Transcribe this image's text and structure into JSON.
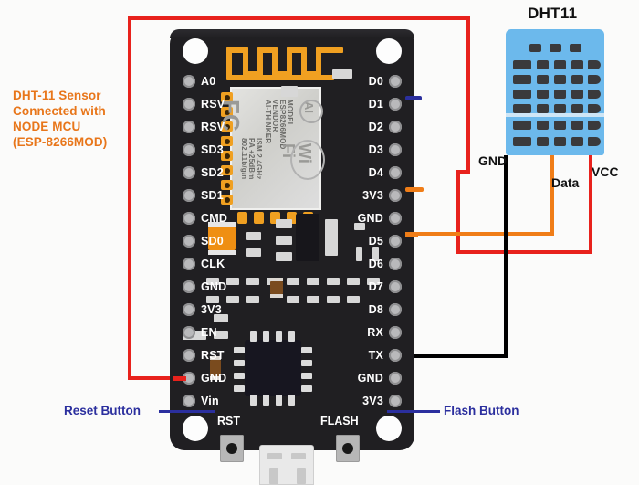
{
  "diagram": {
    "title_note": {
      "lines": [
        "DHT-11 Sensor",
        "Connected with",
        "NODE MCU",
        "(ESP-8266MOD)"
      ],
      "color": "#e8761a"
    },
    "sensor": {
      "name": "DHT11",
      "body_color": "#6cb9ec",
      "leads": [
        {
          "label": "GND",
          "color": "#000000"
        },
        {
          "label": "Data",
          "color": "#f07d17"
        },
        {
          "label": "VCC",
          "color": "#e8221c"
        }
      ]
    },
    "board": {
      "name": "NodeMCU ESP-8266MOD",
      "pins_left": [
        "A0",
        "RSV",
        "RSV",
        "SD3",
        "SD2",
        "SD1",
        "CMD",
        "SD0",
        "CLK",
        "GND",
        "3V3",
        "EN",
        "RST",
        "GND",
        "Vin"
      ],
      "pins_right": [
        "D0",
        "D1",
        "D2",
        "D3",
        "D4",
        "3V3",
        "GND",
        "D5",
        "D6",
        "D7",
        "D8",
        "RX",
        "TX",
        "GND",
        "3V3"
      ],
      "module": {
        "model_label": "MODEL",
        "model_value": "ESP8266MOD",
        "vendor_label": "VENDOR",
        "vendor_value": "AI-THINKER",
        "spec_ism": "ISM 2.4GHz",
        "spec_pa": "PA +25dBm",
        "spec_std": "802.11b/g/n",
        "logo_fc": "FC",
        "logo_ai": "AI",
        "logo_wifi_1": "Wi",
        "logo_wifi_2": "Fi"
      },
      "buttons": [
        {
          "caption": "RST",
          "annotation": "Reset Button"
        },
        {
          "caption": "FLASH",
          "annotation": "Flash Button"
        }
      ]
    },
    "connections": [
      {
        "from": "DHT11 VCC",
        "to": "Vin",
        "color": "#e8221c"
      },
      {
        "from": "DHT11 Data",
        "to": "D5",
        "color": "#f07d17"
      },
      {
        "from": "DHT11 GND",
        "to": "GND",
        "color": "#000000"
      }
    ],
    "annotation_color": "#2b2f9e"
  }
}
